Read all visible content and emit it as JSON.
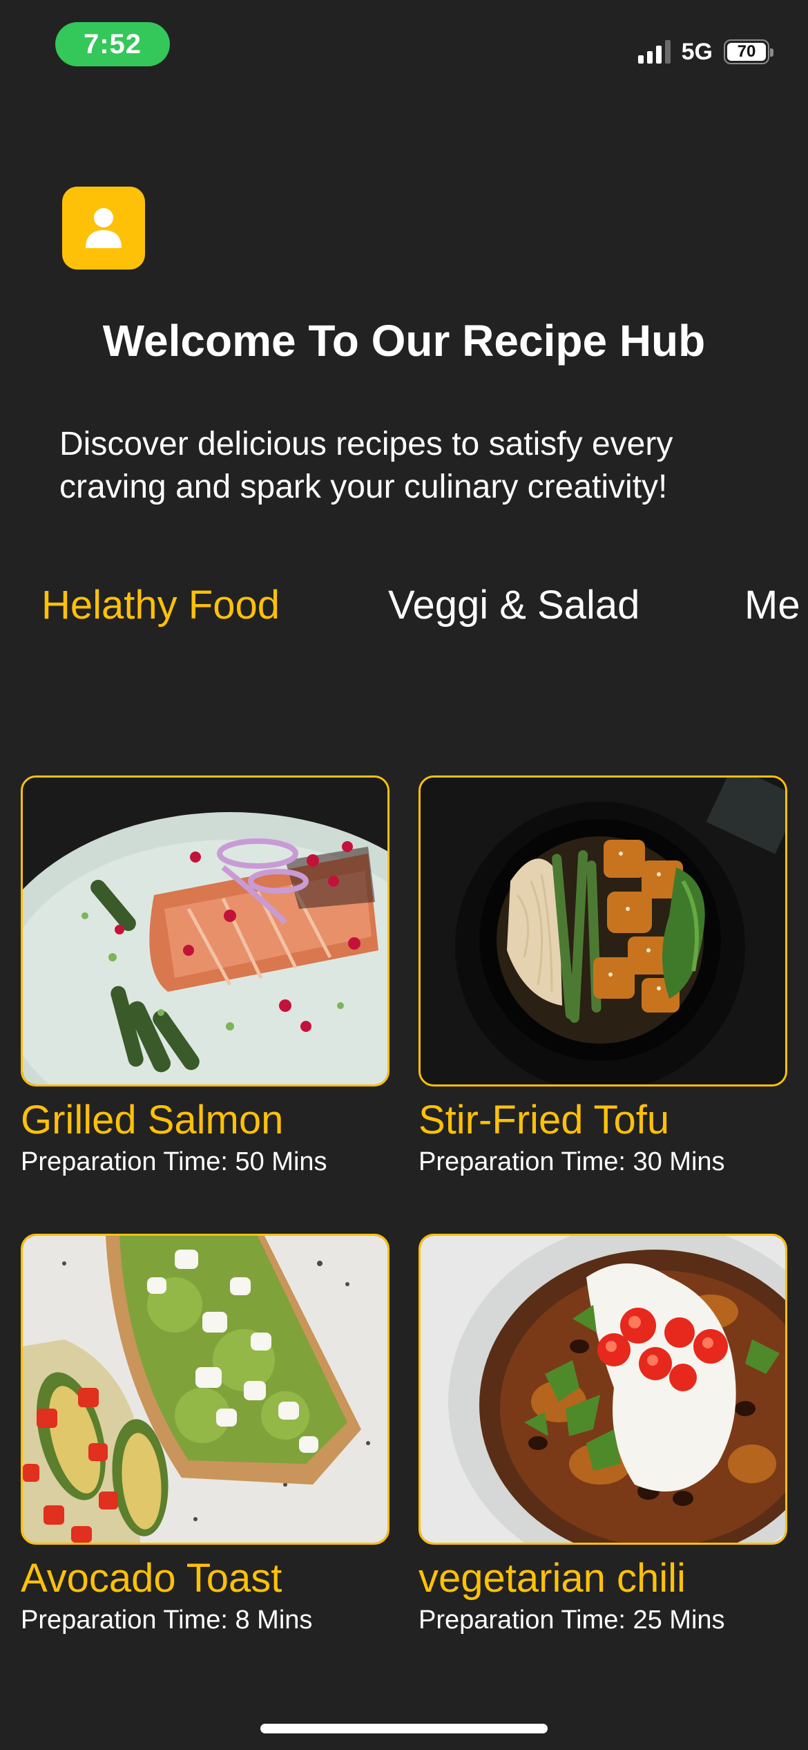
{
  "status_bar": {
    "time": "7:52",
    "network": "5G",
    "battery": "70",
    "signal_icon": "cellular-signal-icon",
    "battery_icon": "battery-icon"
  },
  "header": {
    "profile_icon": "user-icon",
    "title": "Welcome To Our Recipe Hub",
    "subtitle": "Discover delicious recipes to satisfy every craving and spark your culinary creativity!"
  },
  "categories": [
    {
      "label": "Helathy Food",
      "active": true
    },
    {
      "label": "Veggi & Salad",
      "active": false
    },
    {
      "label": "Me",
      "active": false
    }
  ],
  "recipes": [
    {
      "name": "Grilled Salmon",
      "prep_time": "Preparation Time: 50 Mins"
    },
    {
      "name": "Stir-Fried Tofu",
      "prep_time": "Preparation Time: 30 Mins"
    },
    {
      "name": "Avocado Toast",
      "prep_time": "Preparation Time: 8 Mins"
    },
    {
      "name": "vegetarian chili",
      "prep_time": "Preparation Time: 25 Mins"
    }
  ],
  "colors": {
    "background": "#222222",
    "accent": "#ffc107",
    "status_time_bg": "#34c759",
    "text": "#ffffff"
  }
}
